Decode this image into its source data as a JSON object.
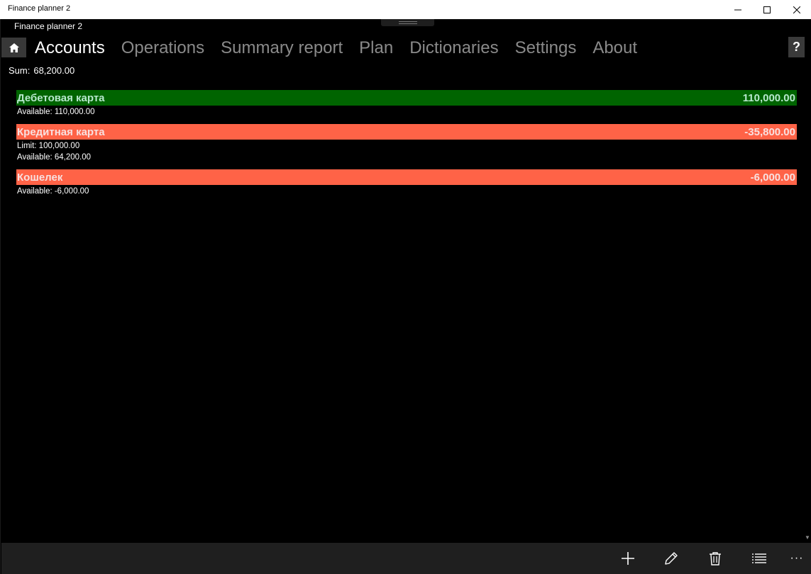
{
  "window": {
    "title": "Finance planner 2",
    "controls": [
      "minimize-icon",
      "maximize-icon",
      "close-icon"
    ]
  },
  "app": {
    "title": "Finance planner 2",
    "help_label": "?"
  },
  "nav": {
    "tabs": [
      {
        "label": "Accounts",
        "active": true
      },
      {
        "label": "Operations",
        "active": false
      },
      {
        "label": "Summary report",
        "active": false
      },
      {
        "label": "Plan",
        "active": false
      },
      {
        "label": "Dictionaries",
        "active": false
      },
      {
        "label": "Settings",
        "active": false
      },
      {
        "label": "About",
        "active": false
      }
    ]
  },
  "summary": {
    "label": "Sum:",
    "value": "68,200.00"
  },
  "accounts": [
    {
      "name": "Дебетовая карта",
      "balance": "110,000.00",
      "status": "positive",
      "details": [
        "Available: 110,000.00"
      ]
    },
    {
      "name": "Кредитная карта",
      "balance": "-35,800.00",
      "status": "negative",
      "details": [
        "Limit: 100,000.00",
        "Available: 64,200.00"
      ]
    },
    {
      "name": "Кошелек",
      "balance": "-6,000.00",
      "status": "negative",
      "details": [
        "Available: -6,000.00"
      ]
    }
  ],
  "commandbar": {
    "buttons": [
      "add-icon",
      "edit-icon",
      "delete-icon",
      "list-icon"
    ],
    "more_label": "···"
  },
  "colors": {
    "positive": "#006400",
    "negative": "#ff6347",
    "inactive_tab": "#8a8a8a"
  }
}
